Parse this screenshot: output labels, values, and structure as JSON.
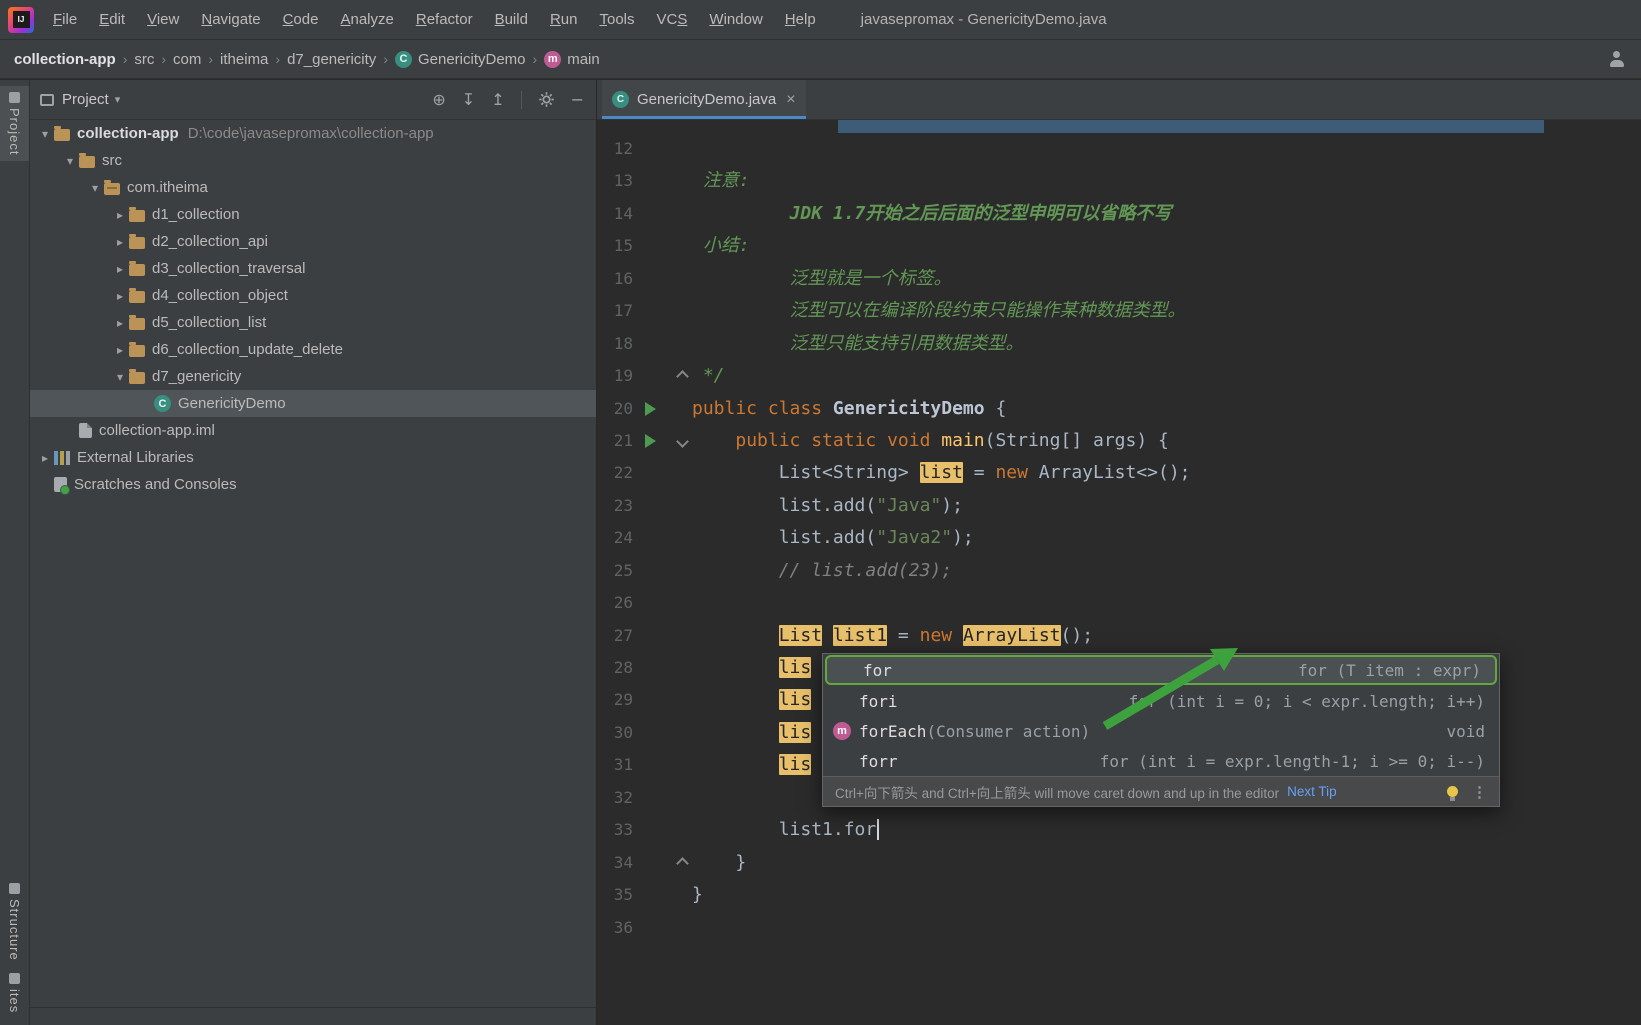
{
  "window": {
    "title": "javasepromax - GenericityDemo.java"
  },
  "menubar": {
    "items": [
      {
        "label": "File",
        "u": 0
      },
      {
        "label": "Edit",
        "u": 0
      },
      {
        "label": "View",
        "u": 0
      },
      {
        "label": "Navigate",
        "u": 0
      },
      {
        "label": "Code",
        "u": 0
      },
      {
        "label": "Analyze",
        "u": 0
      },
      {
        "label": "Refactor",
        "u": 0
      },
      {
        "label": "Build",
        "u": 0
      },
      {
        "label": "Run",
        "u": 0
      },
      {
        "label": "Tools",
        "u": 0
      },
      {
        "label": "VCS",
        "u": 2
      },
      {
        "label": "Window",
        "u": 0
      },
      {
        "label": "Help",
        "u": 0
      }
    ]
  },
  "breadcrumbs": [
    {
      "label": "collection-app",
      "bold": true
    },
    {
      "label": "src"
    },
    {
      "label": "com"
    },
    {
      "label": "itheima"
    },
    {
      "label": "d7_genericity"
    },
    {
      "label": "GenericityDemo",
      "icon": "class"
    },
    {
      "label": "main",
      "icon": "method"
    }
  ],
  "left_strip": {
    "top": [
      {
        "label": "Project",
        "active": true
      }
    ],
    "bottom": [
      {
        "label": "Structure"
      },
      {
        "label": "ites"
      }
    ]
  },
  "project_panel": {
    "title": "Project",
    "tree": [
      {
        "label": "collection-app",
        "suffix": "D:\\code\\javasepromax\\collection-app",
        "icon": "folder",
        "chevron": "open",
        "indent": 0,
        "bold": true
      },
      {
        "label": "src",
        "icon": "folder",
        "chevron": "open",
        "indent": 1
      },
      {
        "label": "com.itheima",
        "icon": "package",
        "chevron": "open",
        "indent": 2
      },
      {
        "label": "d1_collection",
        "icon": "folder",
        "chevron": "closed",
        "indent": 3
      },
      {
        "label": "d2_collection_api",
        "icon": "folder",
        "chevron": "closed",
        "indent": 3
      },
      {
        "label": "d3_collection_traversal",
        "icon": "folder",
        "chevron": "closed",
        "indent": 3
      },
      {
        "label": "d4_collection_object",
        "icon": "folder",
        "chevron": "closed",
        "indent": 3
      },
      {
        "label": "d5_collection_list",
        "icon": "folder",
        "chevron": "closed",
        "indent": 3
      },
      {
        "label": "d6_collection_update_delete",
        "icon": "folder",
        "chevron": "closed",
        "indent": 3
      },
      {
        "label": "d7_genericity",
        "icon": "folder",
        "chevron": "open",
        "indent": 3
      },
      {
        "label": "GenericityDemo",
        "icon": "class",
        "chevron": "none",
        "indent": 4,
        "selected": true
      },
      {
        "label": "collection-app.iml",
        "icon": "file",
        "chevron": "none",
        "indent": 1
      },
      {
        "label": "External Libraries",
        "icon": "library",
        "chevron": "closed",
        "indent": 0
      },
      {
        "label": "Scratches and Consoles",
        "icon": "scratch",
        "chevron": "none",
        "indent": 0
      }
    ]
  },
  "editor": {
    "tab": {
      "label": "GenericityDemo.java"
    },
    "lines": [
      {
        "n": 12,
        "seg": []
      },
      {
        "n": 13,
        "seg": [
          [
            "cmt",
            " 注意:"
          ]
        ]
      },
      {
        "n": 14,
        "seg": [
          [
            "cmtb",
            "         JDK 1.7开始之后后面的泛型申明可以省略不写"
          ]
        ]
      },
      {
        "n": 15,
        "seg": [
          [
            "cmt",
            " 小结:"
          ]
        ]
      },
      {
        "n": 16,
        "seg": [
          [
            "cmt",
            "         泛型就是一个标签。"
          ]
        ]
      },
      {
        "n": 17,
        "seg": [
          [
            "cmt",
            "         泛型可以在编译阶段约束只能操作某种数据类型。"
          ]
        ]
      },
      {
        "n": 18,
        "seg": [
          [
            "cmt",
            "         泛型只能支持引用数据类型。"
          ]
        ]
      },
      {
        "n": 19,
        "seg": [
          [
            "cmt",
            " */"
          ]
        ],
        "fold": "up"
      },
      {
        "n": 20,
        "seg": [
          [
            "kw",
            "public class "
          ],
          [
            "cls",
            "GenericityDemo"
          ],
          [
            "def",
            " {"
          ]
        ],
        "run": true
      },
      {
        "n": 21,
        "seg": [
          [
            "def",
            "    "
          ],
          [
            "kw",
            "public static void "
          ],
          [
            "fn",
            "main"
          ],
          [
            "def",
            "(String[] args) {"
          ]
        ],
        "run": true,
        "fold": "down"
      },
      {
        "n": 22,
        "seg": [
          [
            "def",
            "        List<String> "
          ],
          [
            "hl",
            "list"
          ],
          [
            "def",
            " = "
          ],
          [
            "kw",
            "new"
          ],
          [
            "def",
            " ArrayList<>();"
          ]
        ]
      },
      {
        "n": 23,
        "seg": [
          [
            "def",
            "        list.add("
          ],
          [
            "str",
            "\"Java\""
          ],
          [
            "def",
            ");"
          ]
        ]
      },
      {
        "n": 24,
        "seg": [
          [
            "def",
            "        list.add("
          ],
          [
            "str",
            "\"Java2\""
          ],
          [
            "def",
            ");"
          ]
        ]
      },
      {
        "n": 25,
        "seg": [
          [
            "lcmt",
            "        // list.add(23);"
          ]
        ]
      },
      {
        "n": 26,
        "seg": []
      },
      {
        "n": 27,
        "seg": [
          [
            "def",
            "        "
          ],
          [
            "hl",
            "List"
          ],
          [
            "def",
            " "
          ],
          [
            "hl",
            "list1"
          ],
          [
            "def",
            " = "
          ],
          [
            "kw",
            "new"
          ],
          [
            "def",
            " "
          ],
          [
            "hl",
            "ArrayList"
          ],
          [
            "def",
            "();"
          ]
        ]
      },
      {
        "n": 28,
        "seg": [
          [
            "def",
            "        "
          ],
          [
            "hl",
            "lis"
          ]
        ]
      },
      {
        "n": 29,
        "seg": [
          [
            "def",
            "        "
          ],
          [
            "hl",
            "lis"
          ]
        ]
      },
      {
        "n": 30,
        "seg": [
          [
            "def",
            "        "
          ],
          [
            "hl",
            "lis"
          ]
        ]
      },
      {
        "n": 31,
        "seg": [
          [
            "def",
            "        "
          ],
          [
            "hl",
            "lis"
          ]
        ]
      },
      {
        "n": 32,
        "seg": []
      },
      {
        "n": 33,
        "seg": [
          [
            "def",
            "        list1.for"
          ]
        ],
        "caret": true
      },
      {
        "n": 34,
        "seg": [
          [
            "def",
            "    }"
          ]
        ],
        "fold": "up"
      },
      {
        "n": 35,
        "seg": [
          [
            "def",
            "}"
          ]
        ]
      },
      {
        "n": 36,
        "seg": []
      }
    ],
    "completion": {
      "rows": [
        {
          "name": "for",
          "params": "",
          "detail": "for (T item : expr)",
          "selected": true
        },
        {
          "name": "fori",
          "params": "",
          "detail": "for (int i = 0; i < expr.length; i++)"
        },
        {
          "name": "forEach",
          "params": "(Consumer action)",
          "detail": "void",
          "icon": "method"
        },
        {
          "name": "forr",
          "params": "",
          "detail": "for (int i = expr.length-1; i >= 0; i--)"
        }
      ],
      "footer_hint": "Ctrl+向下箭头 and Ctrl+向上箭头 will move caret down and up in the editor",
      "footer_link": "Next Tip"
    }
  },
  "colors": {
    "accent_blue": "#4a88c7",
    "highlight_tan": "#e8bf6a",
    "annotation_green": "#3da13d",
    "run_green": "#4c9b51",
    "keyword_orange": "#cc7832",
    "string_green": "#6a8759",
    "comment_green": "#629755"
  }
}
